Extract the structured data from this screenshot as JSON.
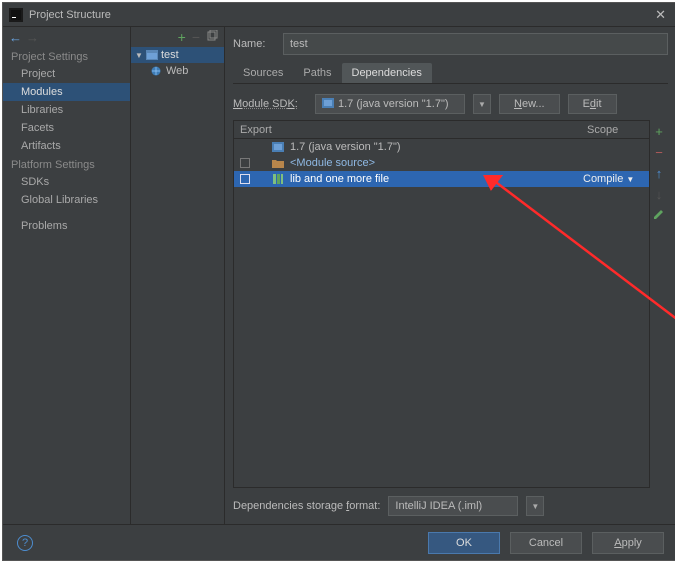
{
  "window": {
    "title": "Project Structure"
  },
  "left": {
    "section1": "Project Settings",
    "items1": [
      "Project",
      "Modules",
      "Libraries",
      "Facets",
      "Artifacts"
    ],
    "selected1": "Modules",
    "section2": "Platform Settings",
    "items2": [
      "SDKs",
      "Global Libraries"
    ],
    "section3": "",
    "items3": [
      "Problems"
    ]
  },
  "tree": {
    "root": "test",
    "child": "Web"
  },
  "form": {
    "name_label": "Name:",
    "name_value": "test"
  },
  "tabs": {
    "items": [
      "Sources",
      "Paths",
      "Dependencies"
    ],
    "active": "Dependencies"
  },
  "sdk": {
    "label": "Module SDK:",
    "value": "1.7 (java version \"1.7\")",
    "new_btn": "New...",
    "edit_btn": "Edit"
  },
  "table": {
    "head_export": "Export",
    "head_scope": "Scope",
    "rows": [
      {
        "label": "1.7 (java version \"1.7\")",
        "link": false,
        "checkbox": true,
        "icon": "jdk"
      },
      {
        "label": "<Module source>",
        "link": true,
        "checkbox": true,
        "icon": "folder"
      },
      {
        "label": "lib and one more file",
        "link": false,
        "checkbox": true,
        "selected": true,
        "icon": "lib",
        "scope": "Compile"
      }
    ]
  },
  "dep": {
    "label": "Dependencies storage format:",
    "value": "IntelliJ IDEA (.iml)"
  },
  "footer": {
    "ok": "OK",
    "cancel": "Cancel",
    "apply": "Apply"
  }
}
